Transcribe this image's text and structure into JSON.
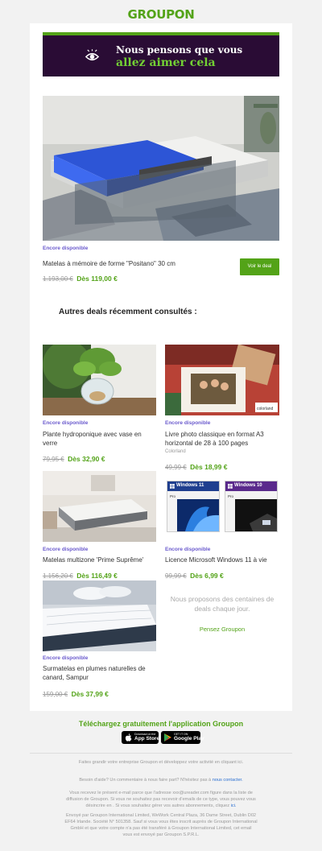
{
  "header": {
    "logo": "GROUPON"
  },
  "banner": {
    "line1": "Nous pensons que vous",
    "line2": "allez aimer cela"
  },
  "featured": {
    "availability": "Encore disponible",
    "title": "Matelas à mémoire de forme \"Positano\" 30 cm",
    "price_old": "1.193,00 €",
    "price_new": "Dès 119,00 €",
    "cta": "Voir le deal"
  },
  "section_title": "Autres deals récemment consultés :",
  "deals": [
    {
      "availability": "Encore disponible",
      "title_line1": "Plante hydroponique avec vase en",
      "title_line2": "verre",
      "brand": "",
      "price_old": "79,95 €",
      "price_new": "Dès 32,90 €"
    },
    {
      "availability": "Encore disponible",
      "title_line1": "Livre photo classique en format A3",
      "title_line2": "horizontal de 28 à 100 pages",
      "brand": "Colorland",
      "price_old": "49,99 €",
      "price_new": "Dès 18,99 €"
    },
    {
      "availability": "Encore disponible",
      "title_line1": "Matelas multizone 'Prime Suprême'",
      "title_line2": "",
      "brand": "",
      "price_old": "1.156,20 €",
      "price_new": "Dès 116,49 €"
    },
    {
      "availability": "Encore disponible",
      "title_line1": "Licence Microsoft Windows 11 à vie",
      "title_line2": "",
      "brand": "",
      "price_old": "99,99 €",
      "price_new": "Dès 6,99 €"
    },
    {
      "availability": "Encore disponible",
      "title_line1": "Surmatelas en plumes naturelles de",
      "title_line2": "canard, Sampur",
      "brand": "",
      "price_old": "159,00 €",
      "price_new": "Dès 37,99 €"
    }
  ],
  "win": {
    "w11": "Windows 11",
    "w10": "Windows 10",
    "pro": "Pro"
  },
  "photo_brand": "colorland",
  "promo": {
    "text": "Nous proposons des centaines de deals chaque jour.",
    "link": "Pensez Groupon"
  },
  "app": {
    "title": "Téléchargez gratuitement l'application Groupon",
    "appstore_small": "Download on the",
    "appstore": "App Store",
    "gplay_small": "GET IT ON",
    "gplay": "Google Play"
  },
  "footer": {
    "business": "Faites grandir votre entreprise Groupon et développez votre activité en cliquant ici.",
    "help_prefix": "Besoin d'aide? Un commentaire à nous faire part? N'hésitez pas à",
    "help_link": "nous contacter.",
    "legal1_a": "Vous recevez le présent e-mail parce que l'adresse xxx@ureader.com figure dans la liste de",
    "legal1_b": "diffusion de Groupon. Si vous ne souhaitez pas recevoir d'emails de ce type, vous pouvez vous",
    "legal1_c": "désincrire en . Si vous souhaitez gérer vos autres abonnements, cliquez",
    "legal1_link": "ici.",
    "legal2_a": "Envoyé par Groupon International Limited, WeWork Central Plaza, 36 Dame Street, Dublin D02",
    "legal2_b": "EF64 Irlande. Société N° 501358. Sauf si vous vous êtes inscrit auprès de Groupon International",
    "legal2_c": "GmbH et que votre compte n'a pas été transféré à Groupon International Limited, cet email",
    "legal2_d": "vous est envoyé par Groupon S.P.R.L."
  }
}
